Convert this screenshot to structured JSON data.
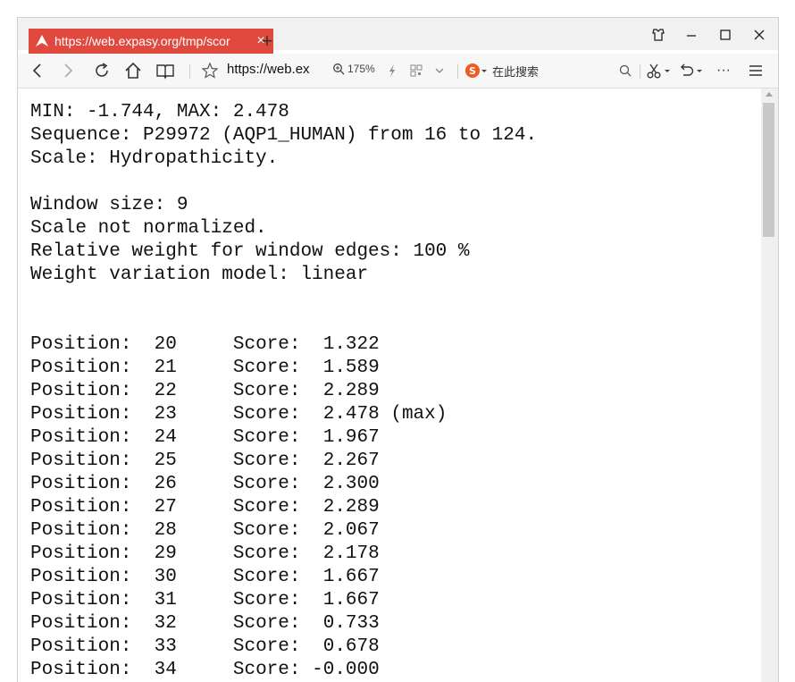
{
  "tab": {
    "title": "https://web.expasy.org/tmp/scor",
    "close": "×",
    "new_tab": "+"
  },
  "toolbar": {
    "url": "https://web.ex",
    "zoom": "175%",
    "search_engine_label": "在此搜索",
    "more": "···"
  },
  "content": {
    "header_lines": [
      "MIN: -1.744, MAX: 2.478",
      "Sequence: P29972 (AQP1_HUMAN) from 16 to 124.",
      "Scale: Hydropathicity."
    ],
    "param_lines": [
      "Window size: 9",
      "Scale not normalized.",
      "Relative weight for window edges: 100 %",
      "Weight variation model: linear"
    ],
    "rows": [
      {
        "pos_label": "Position:",
        "pos": "20",
        "score_label": "Score:",
        "score": " 1.322",
        "note": ""
      },
      {
        "pos_label": "Position:",
        "pos": "21",
        "score_label": "Score:",
        "score": " 1.589",
        "note": ""
      },
      {
        "pos_label": "Position:",
        "pos": "22",
        "score_label": "Score:",
        "score": " 2.289",
        "note": ""
      },
      {
        "pos_label": "Position:",
        "pos": "23",
        "score_label": "Score:",
        "score": " 2.478",
        "note": "(max)"
      },
      {
        "pos_label": "Position:",
        "pos": "24",
        "score_label": "Score:",
        "score": " 1.967",
        "note": ""
      },
      {
        "pos_label": "Position:",
        "pos": "25",
        "score_label": "Score:",
        "score": " 2.267",
        "note": ""
      },
      {
        "pos_label": "Position:",
        "pos": "26",
        "score_label": "Score:",
        "score": " 2.300",
        "note": ""
      },
      {
        "pos_label": "Position:",
        "pos": "27",
        "score_label": "Score:",
        "score": " 2.289",
        "note": ""
      },
      {
        "pos_label": "Position:",
        "pos": "28",
        "score_label": "Score:",
        "score": " 2.067",
        "note": ""
      },
      {
        "pos_label": "Position:",
        "pos": "29",
        "score_label": "Score:",
        "score": " 2.178",
        "note": ""
      },
      {
        "pos_label": "Position:",
        "pos": "30",
        "score_label": "Score:",
        "score": " 1.667",
        "note": ""
      },
      {
        "pos_label": "Position:",
        "pos": "31",
        "score_label": "Score:",
        "score": " 1.667",
        "note": ""
      },
      {
        "pos_label": "Position:",
        "pos": "32",
        "score_label": "Score:",
        "score": " 0.733",
        "note": ""
      },
      {
        "pos_label": "Position:",
        "pos": "33",
        "score_label": "Score:",
        "score": " 0.678",
        "note": ""
      },
      {
        "pos_label": "Position:",
        "pos": "34",
        "score_label": "Score:",
        "score": "-0.000",
        "note": ""
      }
    ]
  },
  "colors": {
    "tab_active": "#e2493e",
    "search_logo": "#f05a22"
  }
}
